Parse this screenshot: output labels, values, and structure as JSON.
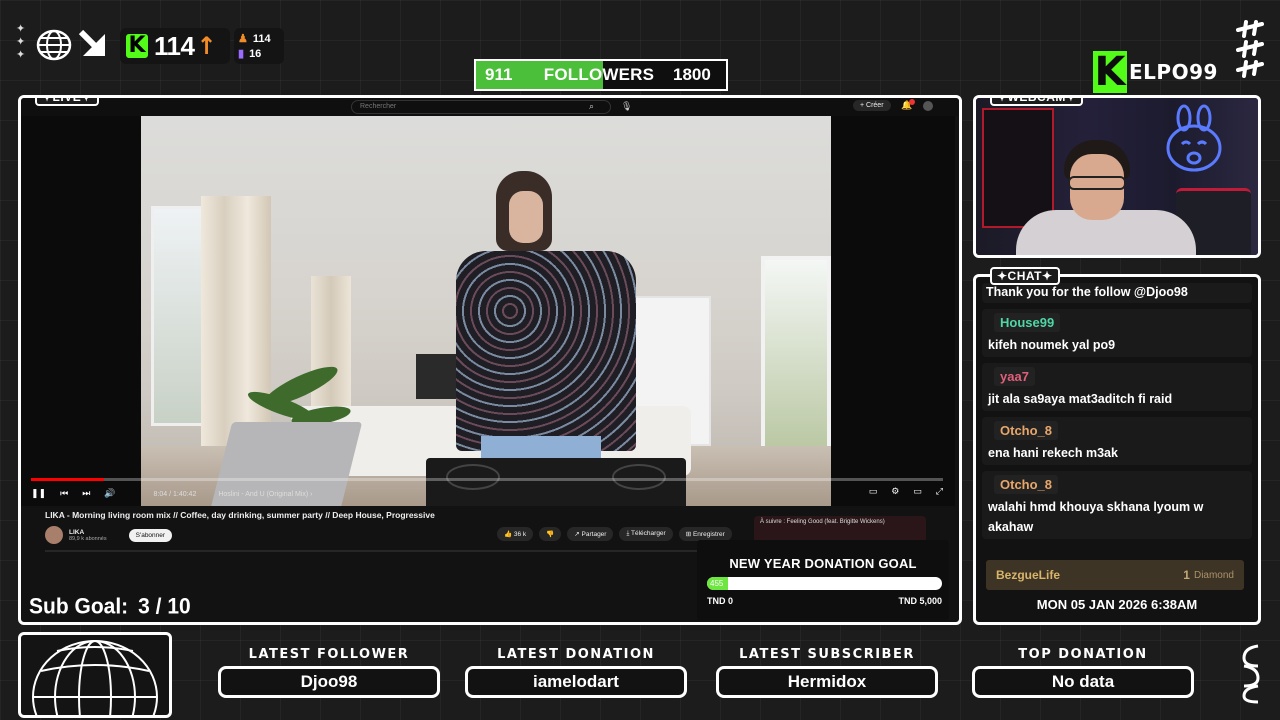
{
  "stats": {
    "sparkles": "✦\n✦\n✦",
    "kick_followers": "114",
    "viewers": "114",
    "subs": "16"
  },
  "followers_goal": {
    "current": "911",
    "label": "FOLLOWERS",
    "target": "1800",
    "fraction": 0.506
  },
  "brand": {
    "logo_letter": "K",
    "name": "ELPO99"
  },
  "live_panel": {
    "tag": "✦LIVE✦",
    "youtube": {
      "search_placeholder": "Rechercher",
      "create_label": "+ Créer",
      "progress_fraction": 0.08,
      "time": "8:04 / 1:40:42",
      "chapter": "Hoslini - And U (Original Mix) ›",
      "title": "LIKA - Morning living room mix // Coffee, day drinking, summer party // Deep House, Progressive",
      "channel": "LIKA",
      "channel_subs": "89,9 k abonnés",
      "subscribe": "S'abonner",
      "likes": "👍 36 k",
      "dislike": "👎",
      "share": "↗ Partager",
      "download": "⤓ Télécharger",
      "save": "⊞ Enregistrer",
      "next_up": "À suivre : Feeling Good (feat. Brigitte Wickens)"
    },
    "sub_goal_label": "Sub Goal:",
    "sub_goal_value": "3 / 10",
    "donation": {
      "title": "NEW YEAR DONATION GOAL",
      "current": "455",
      "fraction": 0.091,
      "min_label": "TND 0",
      "max_label": "TND 5,000",
      "bar_color": "#6de640"
    }
  },
  "webcam": {
    "tag": "✦WEBCAM✦"
  },
  "chat": {
    "tag": "✦CHAT✦",
    "system_message": "Thank you for the follow @Djoo98",
    "messages": [
      {
        "user": "House99",
        "text": "kifeh noumek yal po9",
        "color": "#4fd6a6"
      },
      {
        "user": "yaa7",
        "text": "jit ala sa9aya mat3aditch fi raid",
        "color": "#e0607a"
      },
      {
        "user": "Otcho_8",
        "text": "ena hani rekech m3ak",
        "color": "#e8a66a"
      },
      {
        "user": "Otcho_8",
        "text": "walahi hmd khouya skhana lyoum w akahaw",
        "color": "#e8a66a"
      }
    ],
    "kick_badge": {
      "user": "BezgueLife",
      "amount": "1",
      "unit": "Diamond"
    },
    "datetime": "MON 05 JAN 2026 6:38AM"
  },
  "bottom": {
    "latest_follower_label": "LATEST FOLLOWER",
    "latest_follower": "Djoo98",
    "latest_donation_label": "LATEST DONATION",
    "latest_donation": "iamelodart",
    "latest_subscriber_label": "LATEST SUBSCRIBER",
    "latest_subscriber": "Hermidox",
    "top_donation_label": "TOP DONATION",
    "top_donation": "No data"
  },
  "colors": {
    "kick_green": "#53fc18",
    "followers_fill": "#4bbf3a",
    "accent_orange": "#f28c28"
  }
}
